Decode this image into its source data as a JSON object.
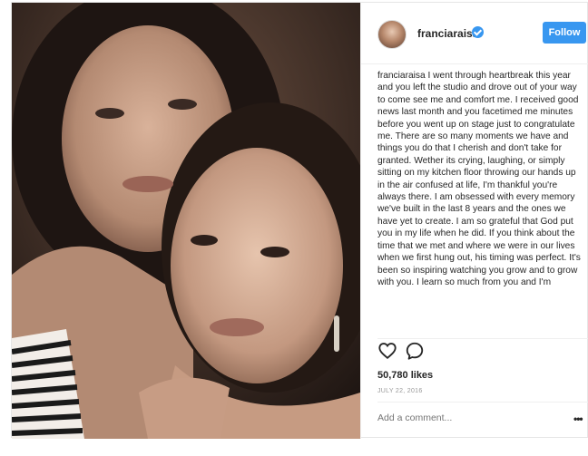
{
  "post": {
    "username": "franciaraisa",
    "follow_label": "Follow",
    "caption_user": "franciaraisa",
    "caption_text": "I went through heartbreak this year and you left the studio and drove out of your way to come see me and comfort me. I received good news last month and you facetimed me minutes before you went up on stage just to congratulate me. There are so many moments we have and things you do that I cherish and don't take for granted. Wether its crying, laughing, or simply sitting on my kitchen floor throwing our hands up in the air confused at life, I'm thankful you're always there. I am obsessed with every memory we've built in the last 8 years and the ones we have yet to create. I am so grateful that God put you in my life when he did. If you think about the time that we met and where we were in our lives when we first hung out, his timing was perfect. It's been so inspiring watching you grow and to grow with you. I learn so much from you and I'm",
    "likes": "50,780 likes",
    "date": "JULY 22, 2016",
    "comment_placeholder": "Add a comment...",
    "more_label": "•••"
  },
  "icons": {
    "like": "heart-icon",
    "comment": "comment-icon",
    "verified": "verified-badge-icon",
    "more": "more-options-icon"
  },
  "colors": {
    "follow_button": "#3897f0",
    "verified_badge": "#3897f0",
    "border": "#efefef"
  }
}
